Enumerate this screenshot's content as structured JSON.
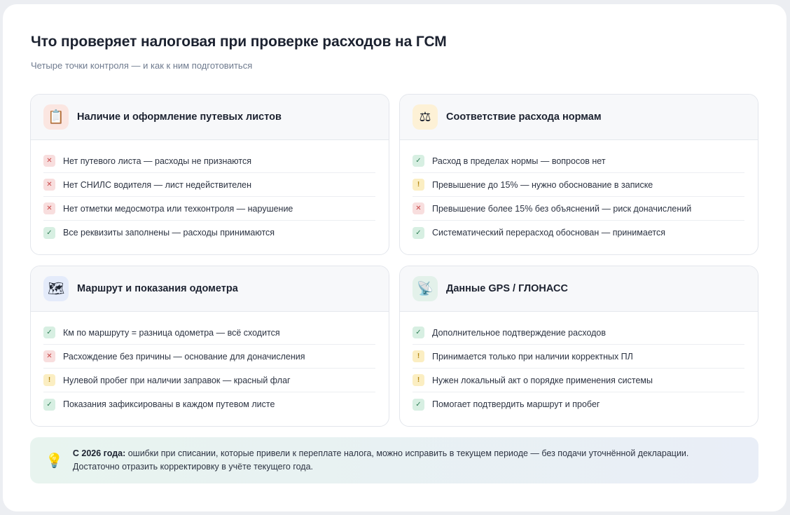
{
  "header": {
    "title": "Что проверяет налоговая при проверке расходов на ГСМ",
    "subtitle": "Четыре точки контроля — и как к ним подготовиться"
  },
  "colors": {
    "bad": "#c94848",
    "ok": "#2f7d55",
    "warn": "#b38715"
  },
  "cards": [
    {
      "title": "Наличие и оформление путевых листов",
      "icon": "clipboard-icon",
      "glyph": "📋",
      "icon_bg": "#fbe6e1",
      "items": [
        {
          "status": "bad",
          "glyph": "✕",
          "text": "Нет путевого листа — расходы не признаются"
        },
        {
          "status": "bad",
          "glyph": "✕",
          "text": "Нет СНИЛС водителя — лист недействителен"
        },
        {
          "status": "bad",
          "glyph": "✕",
          "text": "Нет отметки медосмотра или техконтроля — нарушение"
        },
        {
          "status": "ok",
          "glyph": "✓",
          "text": "Все реквизиты заполнены — расходы принимаются"
        }
      ]
    },
    {
      "title": "Соответствие расхода нормам",
      "icon": "scales-icon",
      "glyph": "⚖",
      "icon_bg": "#fdf1d6",
      "items": [
        {
          "status": "ok",
          "glyph": "✓",
          "text": "Расход в пределах нормы — вопросов нет"
        },
        {
          "status": "warn",
          "glyph": "!",
          "text": "Превышение до 15% — нужно обоснование в записке"
        },
        {
          "status": "bad",
          "glyph": "✕",
          "text": "Превышение более 15% без объяснений — риск доначислений"
        },
        {
          "status": "ok",
          "glyph": "✓",
          "text": "Систематический перерасход обоснован — принимается"
        }
      ]
    },
    {
      "title": "Маршрут и показания одометра",
      "icon": "map-icon",
      "glyph": "🗺",
      "icon_bg": "#e4ebfa",
      "items": [
        {
          "status": "ok",
          "glyph": "✓",
          "text": "Км по маршруту = разница одометра — всё сходится"
        },
        {
          "status": "bad",
          "glyph": "✕",
          "text": "Расхождение без причины — основание для доначисления"
        },
        {
          "status": "warn",
          "glyph": "!",
          "text": "Нулевой пробег при наличии заправок — красный флаг"
        },
        {
          "status": "ok",
          "glyph": "✓",
          "text": "Показания зафиксированы в каждом путевом листе"
        }
      ]
    },
    {
      "title": "Данные GPS / ГЛОНАСС",
      "icon": "satellite-icon",
      "glyph": "📡",
      "icon_bg": "#e3f1ea",
      "items": [
        {
          "status": "ok",
          "glyph": "✓",
          "text": "Дополнительное подтверждение расходов"
        },
        {
          "status": "warn",
          "glyph": "!",
          "text": "Принимается только при наличии корректных ПЛ"
        },
        {
          "status": "warn",
          "glyph": "!",
          "text": "Нужен локальный акт о порядке применения системы"
        },
        {
          "status": "ok",
          "glyph": "✓",
          "text": "Помогает подтвердить маршрут и пробег"
        }
      ]
    }
  ],
  "note": {
    "icon": "lightbulb-icon",
    "glyph": "💡",
    "bold": "С 2026 года:",
    "text": " ошибки при списании, которые привели к переплате налога, можно исправить в текущем периоде — без подачи уточнённой декларации. Достаточно отразить корректировку в учёте текущего года."
  }
}
